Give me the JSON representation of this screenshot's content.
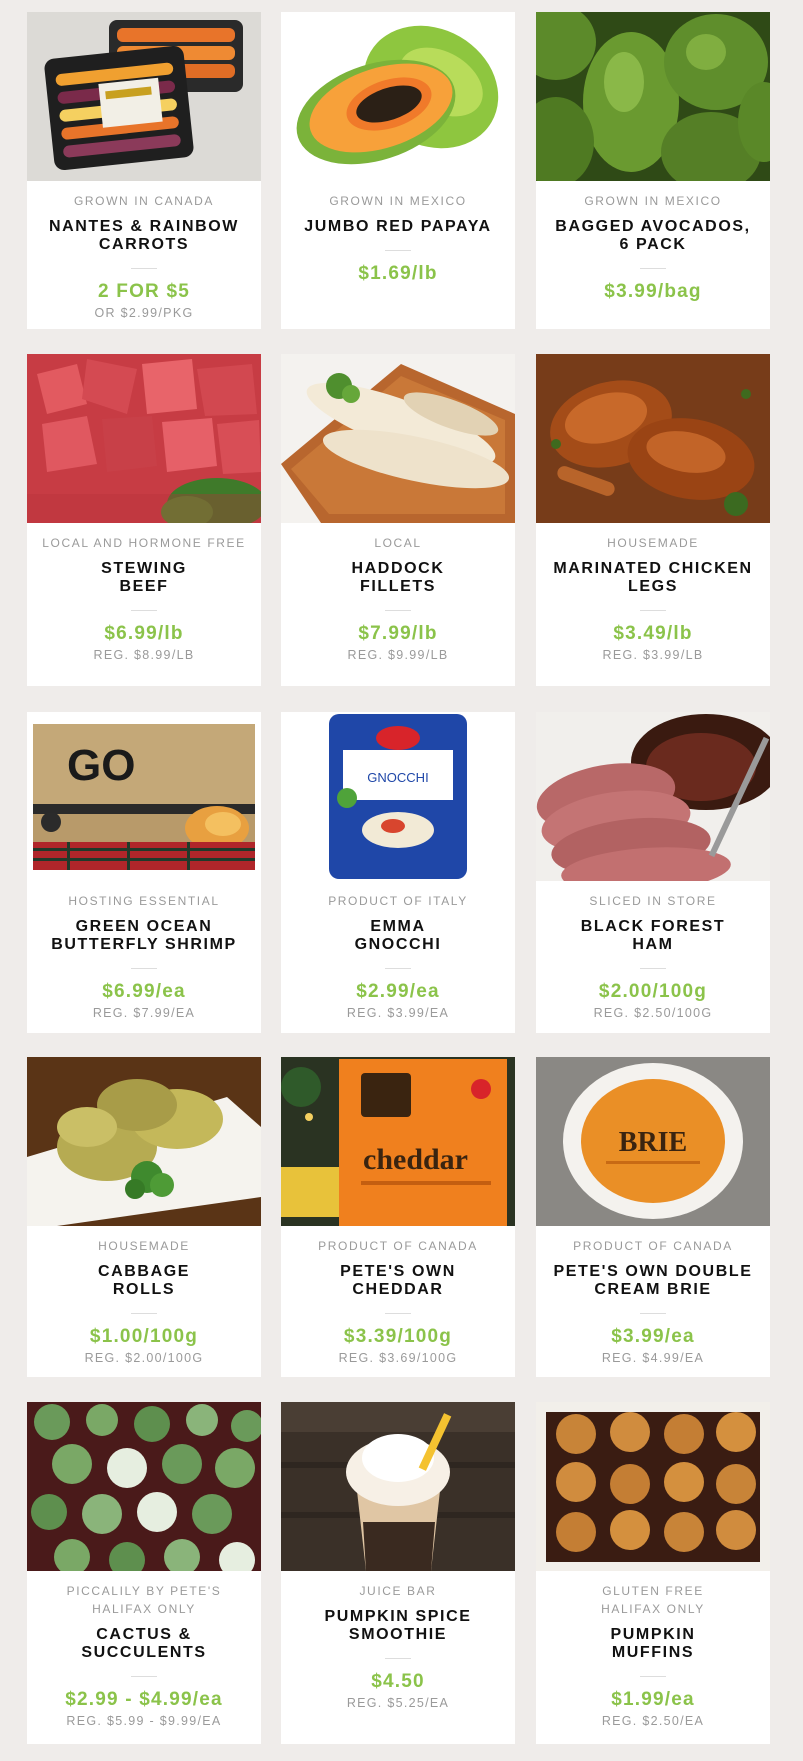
{
  "products": [
    {
      "origin": "GROWN IN CANADA",
      "name": "NANTES & RAINBOW\nCARROTS",
      "price": "2 FOR $5",
      "reg": "OR $2.99/pkg",
      "image": "carrots-photo"
    },
    {
      "origin": "GROWN IN MEXICO",
      "name": "JUMBO RED PAPAYA",
      "price": "$1.69/lb",
      "reg": "",
      "image": "papaya-photo"
    },
    {
      "origin": "GROWN IN MEXICO",
      "name": "BAGGED AVOCADOS,\n6 PACK",
      "price": "$3.99/bag",
      "reg": "",
      "image": "avocados-photo"
    },
    {
      "origin": "LOCAL AND HORMONE FREE",
      "name": "STEWING\nBEEF",
      "price": "$6.99/lb",
      "reg": "REG. $8.99/lb",
      "image": "beef-photo"
    },
    {
      "origin": "LOCAL",
      "name": "HADDOCK\nFILLETS",
      "price": "$7.99/lb",
      "reg": "REG. $9.99/lb",
      "image": "haddock-photo"
    },
    {
      "origin": "HOUSEMADE",
      "name": "MARINATED CHICKEN\nLEGS",
      "price": "$3.49/lb",
      "reg": "REG. $3.99/lb",
      "image": "chicken-photo"
    },
    {
      "origin": "HOSTING ESSENTIAL",
      "name": "GREEN OCEAN\nBUTTERFLY SHRIMP",
      "price": "$6.99/ea",
      "reg": "REG. $7.99/ea",
      "image": "shrimp-box-photo",
      "image_text": "GO"
    },
    {
      "origin": "PRODUCT OF ITALY",
      "name": "EMMA\nGNOCCHI",
      "price": "$2.99/ea",
      "reg": "REG. $3.99/ea",
      "image": "gnocchi-package-photo",
      "image_text": "GNOCCHI"
    },
    {
      "origin": "SLICED IN STORE",
      "name": "BLACK FOREST\nHAM",
      "price": "$2.00/100g",
      "reg": "REG. $2.50/100g",
      "image": "ham-photo"
    },
    {
      "origin": "HOUSEMADE",
      "name": "CABBAGE\nROLLS",
      "price": "$1.00/100g",
      "reg": "REG. $2.00/100g",
      "image": "cabbage-rolls-photo"
    },
    {
      "origin": "PRODUCT OF CANADA",
      "name": "PETE'S OWN\nCHEDDAR",
      "price": "$3.39/100g",
      "reg": "REG. $3.69/100g",
      "image": "cheddar-package-photo",
      "image_text": "cheddar"
    },
    {
      "origin": "PRODUCT OF CANADA",
      "name": "PETE'S OWN DOUBLE\nCREAM BRIE",
      "price": "$3.99/ea",
      "reg": "REG. $4.99/ea",
      "image": "brie-package-photo",
      "image_text": "BRIE"
    },
    {
      "origin": "PICCALILY BY PETE'S\nHALIFAX ONLY",
      "name": "CACTUS &\nSUCCULENTS",
      "price": "$2.99 - $4.99/ea",
      "reg": "REG. $5.99 - $9.99/ea",
      "image": "cactus-photo"
    },
    {
      "origin": "JUICE BAR",
      "name": "PUMPKIN SPICE\nSMOOTHIE",
      "price": "$4.50",
      "reg": "REG. $5.25/ea",
      "image": "smoothie-photo"
    },
    {
      "origin": "GLUTEN FREE\nHALIFAX ONLY",
      "name": "PUMPKIN\nMUFFINS",
      "price": "$1.99/ea",
      "reg": "REG. $2.50/ea",
      "image": "muffins-photo"
    }
  ]
}
